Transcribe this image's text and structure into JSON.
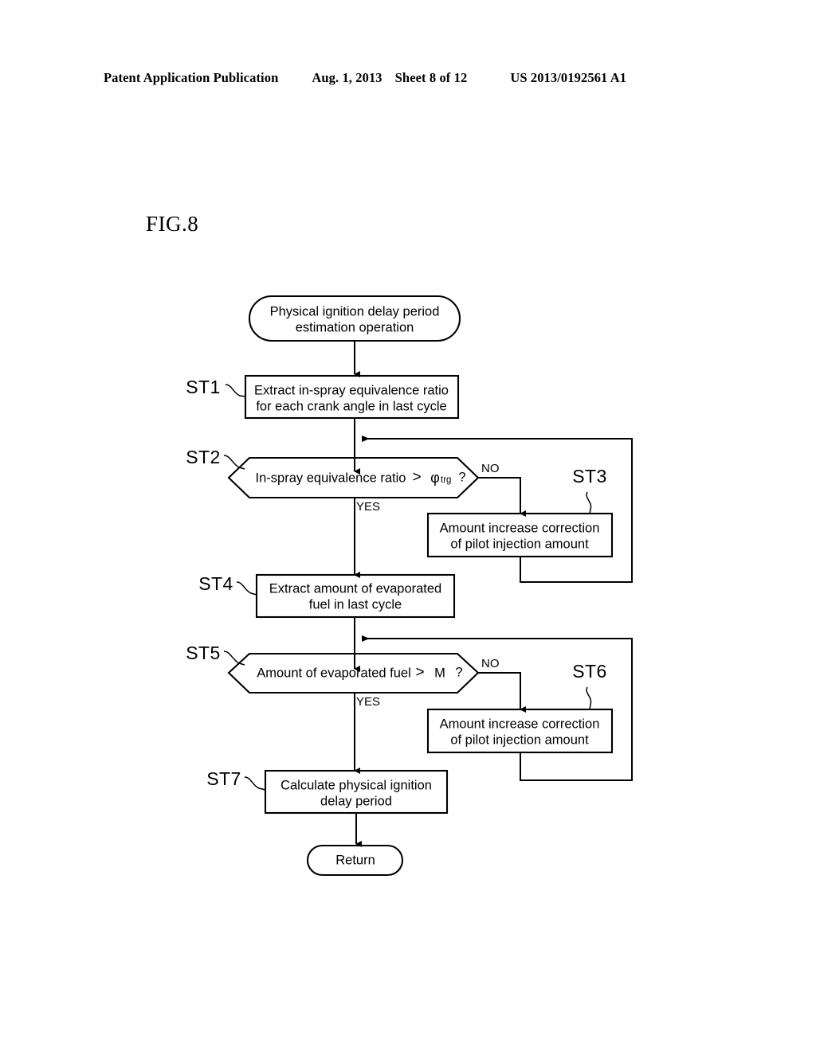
{
  "header": {
    "publication": "Patent Application Publication",
    "date": "Aug. 1, 2013",
    "sheet": "Sheet 8 of 12",
    "number": "US 2013/0192561 A1"
  },
  "figure": {
    "label": "FIG.8"
  },
  "flowchart": {
    "start": {
      "step": "",
      "line1": "Physical ignition delay period",
      "line2": "estimation operation"
    },
    "st1": {
      "step": "ST1",
      "line1": "Extract in-spray equivalence ratio",
      "line2": "for each crank angle in last cycle"
    },
    "st2": {
      "step": "ST2",
      "text_main": "In-spray equivalence ratio",
      "operator": ">",
      "symbol": "φ",
      "subscript": "trg",
      "question": "?",
      "yes_label": "YES",
      "no_label": "NO"
    },
    "st3": {
      "step": "ST3",
      "line1": "Amount increase correction",
      "line2": "of pilot injection amount"
    },
    "st4": {
      "step": "ST4",
      "line1": "Extract amount of evaporated",
      "line2": "fuel in last cycle"
    },
    "st5": {
      "step": "ST5",
      "text_main": "Amount of evaporated fuel",
      "operator": ">",
      "symbol": "M",
      "question": "?",
      "yes_label": "YES",
      "no_label": "NO"
    },
    "st6": {
      "step": "ST6",
      "line1": "Amount increase correction",
      "line2": "of pilot injection amount"
    },
    "st7": {
      "step": "ST7",
      "line1": "Calculate physical ignition",
      "line2": "delay period"
    },
    "end": {
      "label": "Return"
    }
  },
  "colors": {
    "ink": "#000000",
    "paper": "#ffffff"
  }
}
